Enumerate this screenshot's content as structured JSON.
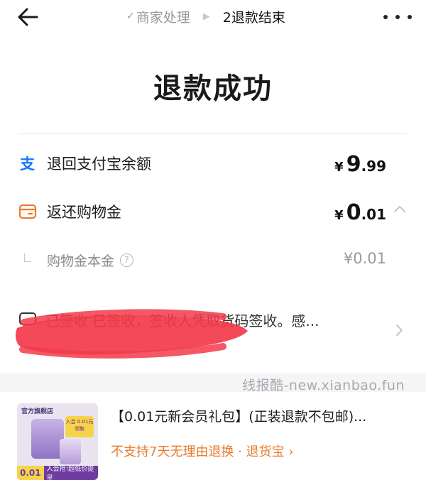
{
  "nav": {
    "step_done": "商家处理",
    "step_active": "2退款结束"
  },
  "title": "退款成功",
  "refunds": [
    {
      "label": "退回支付宝余额",
      "currency": "¥",
      "int": "9",
      "dec": ".99"
    },
    {
      "label": "返还购物金",
      "currency": "¥",
      "int": "0",
      "dec": ".01"
    }
  ],
  "sub": {
    "label": "购物金本金",
    "amount": "¥0.01"
  },
  "logistics": {
    "text": "已签收 已签收，签收人凭取货码签收。感..."
  },
  "watermark": "线报酷-new.xianbao.fun",
  "product": {
    "title": "【0.01元新会员礼包】(正装退款不包邮)...",
    "note": "不支持7天无理由退换 · 退货宝 ›",
    "thumb_store": "官方旗舰店",
    "thumb_badge": "入会 0.01元领取",
    "thumb_price": "0.01",
    "thumb_price_tail": "入会抢!超低价提早"
  },
  "colors": {
    "alipay": "#1677ff",
    "coin": "#f07a2a",
    "note": "#e87a2c",
    "redact": "#f2394a"
  }
}
